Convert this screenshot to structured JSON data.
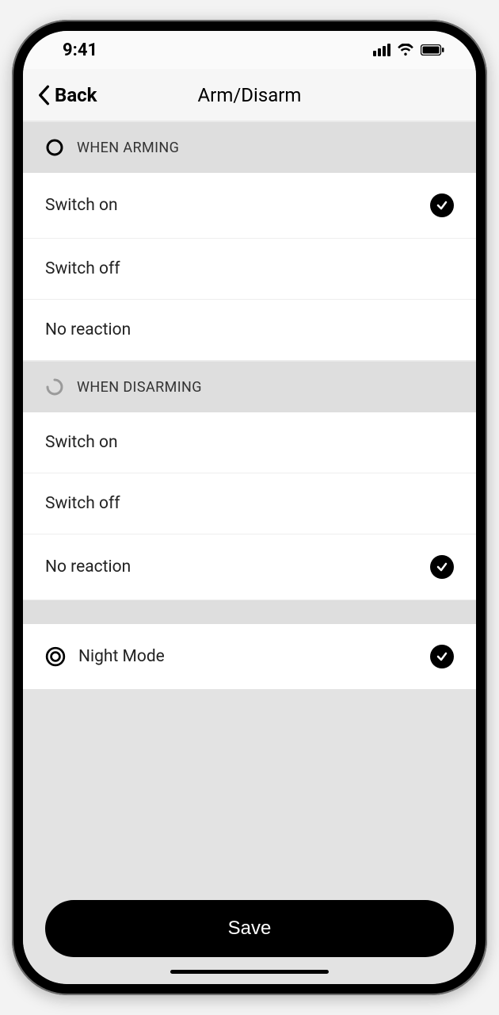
{
  "status": {
    "time": "9:41"
  },
  "nav": {
    "back_label": "Back",
    "title": "Arm/Disarm"
  },
  "sections": {
    "arming": {
      "header": "When Arming",
      "options": [
        {
          "label": "Switch on",
          "selected": true
        },
        {
          "label": "Switch off",
          "selected": false
        },
        {
          "label": "No reaction",
          "selected": false
        }
      ]
    },
    "disarming": {
      "header": "When Disarming",
      "options": [
        {
          "label": "Switch on",
          "selected": false
        },
        {
          "label": "Switch off",
          "selected": false
        },
        {
          "label": "No reaction",
          "selected": true
        }
      ]
    },
    "night": {
      "label": "Night Mode",
      "selected": true
    }
  },
  "footer": {
    "save_label": "Save"
  }
}
